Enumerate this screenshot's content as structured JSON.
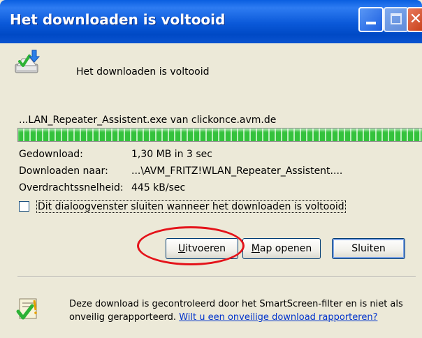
{
  "window": {
    "title": "Het downloaden is voltooid",
    "colors": {
      "titlebar": "#0a58d8",
      "body": "#ece9d8",
      "progress": "#34c23c",
      "highlight": "#e4131a",
      "link": "#0033cc"
    }
  },
  "header": {
    "icon": "download-complete-icon",
    "message": "Het downloaden is voltooid"
  },
  "download": {
    "filename": "...LAN_Repeater_Assistent.exe van clickonce.avm.de",
    "progress": 1.0,
    "rows": [
      {
        "label": "Gedownload:",
        "value": "1,30 MB in 3 sec"
      },
      {
        "label": "Downloaden naar:",
        "value": "...\\AVM_FRITZ!WLAN_Repeater_Assistent...."
      },
      {
        "label": "Overdrachtssnelheid:",
        "value": "445 kB/sec"
      }
    ]
  },
  "options": {
    "close_when_done_label": "Dit dialoogvenster sluiten wanneer het downloaden is voltooid",
    "close_when_done_checked": false
  },
  "buttons": {
    "run_prefix": "",
    "run_mnemonic": "U",
    "run_rest": "itvoeren",
    "open_prefix": "",
    "open_mnemonic": "M",
    "open_rest": "ap openen",
    "close": "Sluiten"
  },
  "smartscreen": {
    "icon": "shield-check-icon",
    "text": "Deze download is gecontroleerd door het SmartScreen-filter en is niet als onveilig gerapporteerd.",
    "link": "Wilt u een onveilige download rapporteren?"
  }
}
